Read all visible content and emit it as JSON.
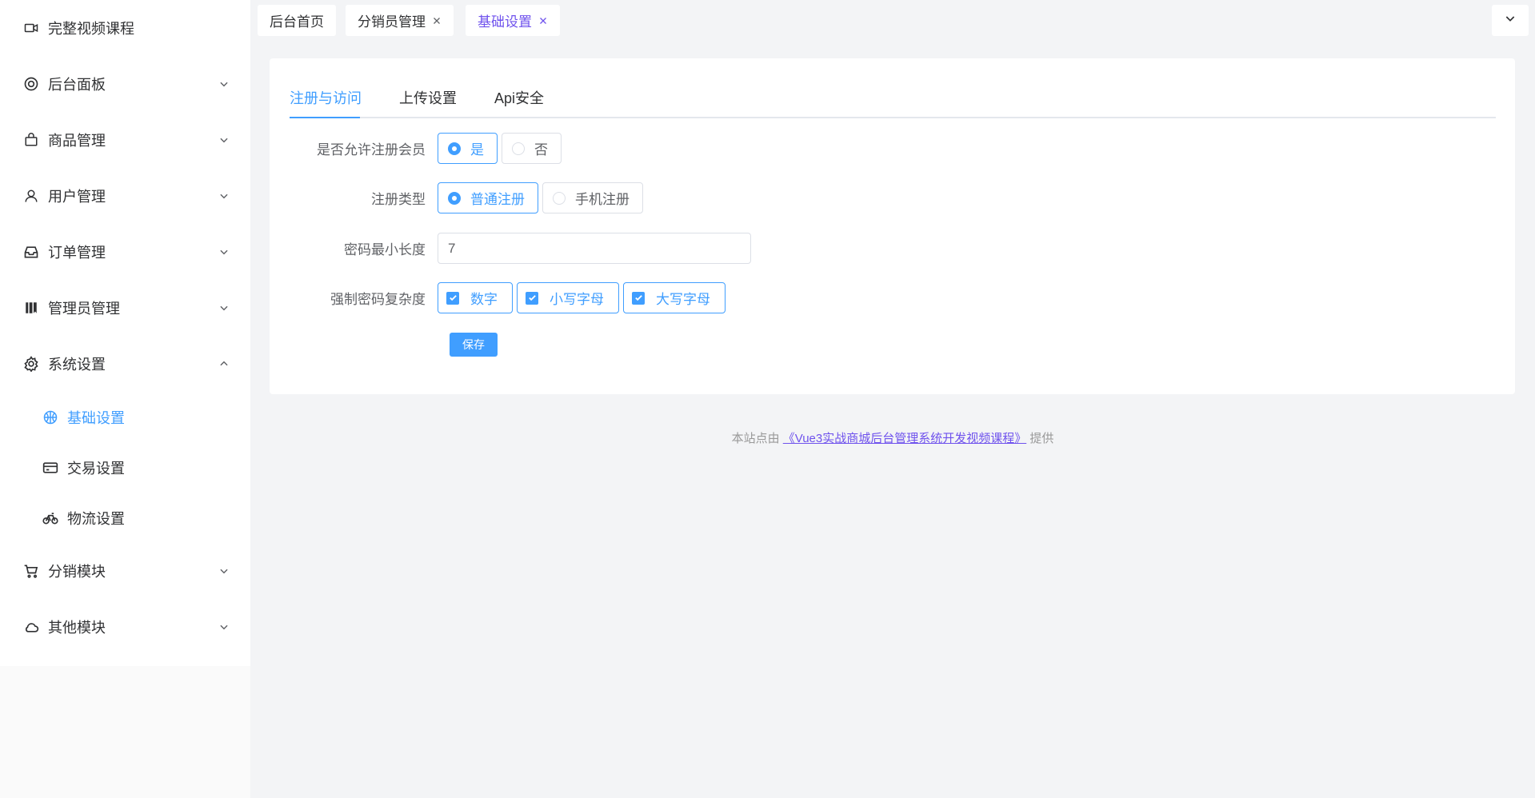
{
  "sidebar": {
    "items": [
      {
        "label": "完整视频课程",
        "icon": "video-camera-icon",
        "expandable": false
      },
      {
        "label": "后台面板",
        "icon": "help-buoy-icon",
        "expandable": true
      },
      {
        "label": "商品管理",
        "icon": "shopping-bag-icon",
        "expandable": true
      },
      {
        "label": "用户管理",
        "icon": "user-icon",
        "expandable": true
      },
      {
        "label": "订单管理",
        "icon": "inbox-icon",
        "expandable": true
      },
      {
        "label": "管理员管理",
        "icon": "notebook-icon",
        "expandable": true
      },
      {
        "label": "系统设置",
        "icon": "gear-icon",
        "expandable": true,
        "expanded": true
      },
      {
        "label": "分销模块",
        "icon": "shopping-cart-icon",
        "expandable": true
      },
      {
        "label": "其他模块",
        "icon": "cloud-icon",
        "expandable": true
      }
    ],
    "sub_items": [
      {
        "label": "基础设置",
        "icon": "basketball-icon",
        "active": true
      },
      {
        "label": "交易设置",
        "icon": "credit-card-icon",
        "active": false
      },
      {
        "label": "物流设置",
        "icon": "bicycle-icon",
        "active": false
      }
    ]
  },
  "tabbar": {
    "tags": [
      {
        "label": "后台首页",
        "closable": false
      },
      {
        "label": "分销员管理",
        "closable": true
      },
      {
        "label": "基础设置",
        "closable": true,
        "active": true
      }
    ]
  },
  "settings": {
    "tabs": [
      "注册与访问",
      "上传设置",
      "Api安全"
    ],
    "active_tab": 0,
    "form": {
      "allow_register": {
        "label": "是否允许注册会员",
        "options": [
          "是",
          "否"
        ],
        "selected": "是"
      },
      "register_type": {
        "label": "注册类型",
        "options": [
          "普通注册",
          "手机注册"
        ],
        "selected": "普通注册"
      },
      "password_min": {
        "label": "密码最小长度",
        "value": "7"
      },
      "password_complexity": {
        "label": "强制密码复杂度",
        "options": [
          "数字",
          "小写字母",
          "大写字母"
        ],
        "checked": [
          "数字",
          "小写字母",
          "大写字母"
        ]
      },
      "save_label": "保存"
    }
  },
  "footer": {
    "prefix": "本站点由",
    "link_text": "《Vue3实战商城后台管理系统开发视频课程》",
    "suffix": "提供"
  },
  "colors": {
    "primary": "#409eff",
    "accent_tag": "#6f52ed",
    "background": "#f3f4f6"
  }
}
